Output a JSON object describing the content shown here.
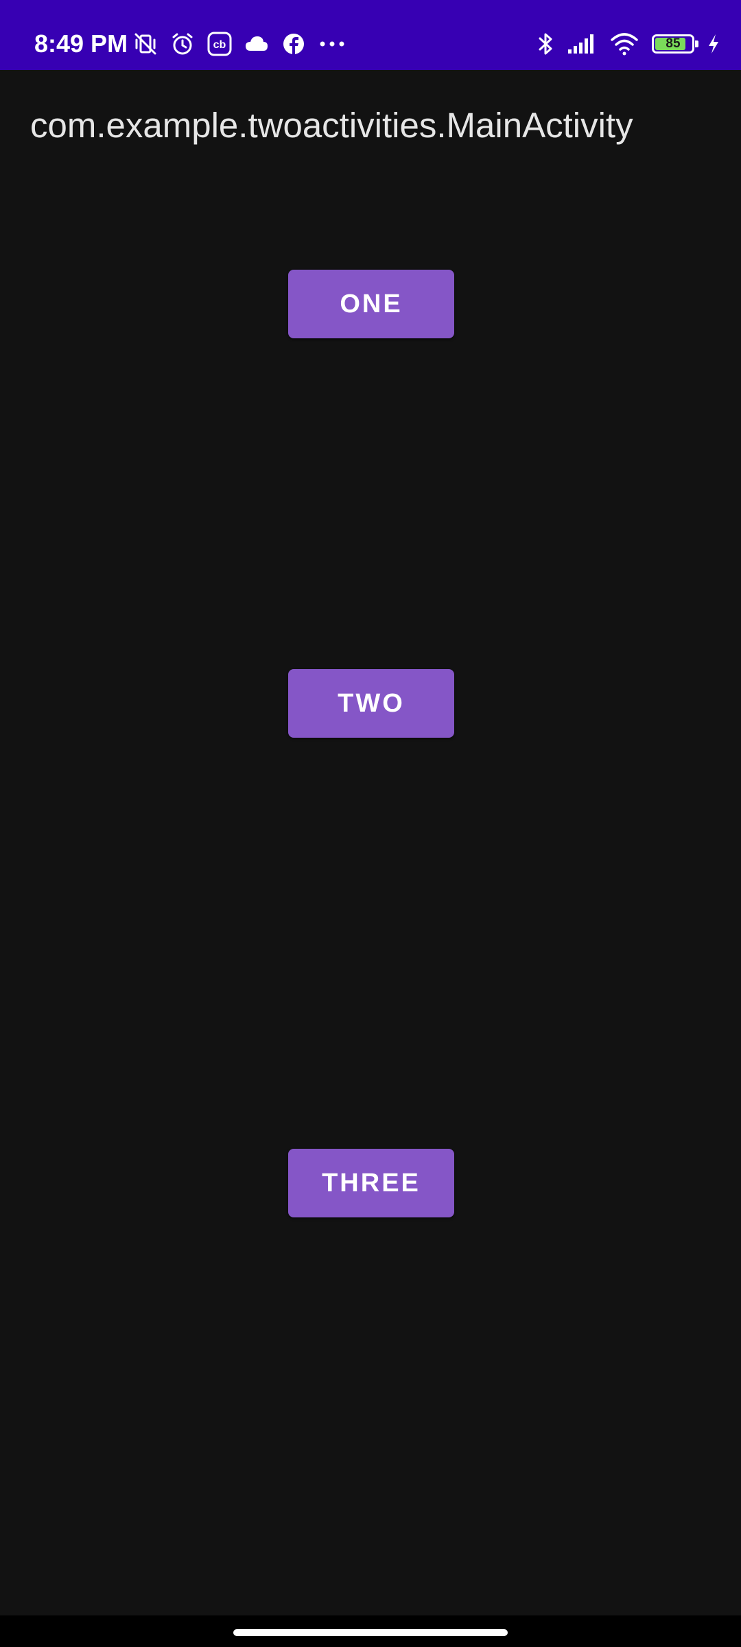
{
  "status_bar": {
    "time": "8:49 PM",
    "battery_level": "85",
    "battery_fraction": 0.85,
    "background_color": "#3700b3",
    "left_icons": [
      "vibrate-off-icon",
      "alarm-icon",
      "cb-app-icon",
      "cloud-icon",
      "facebook-icon",
      "more-dots-icon"
    ],
    "right_icons": [
      "bluetooth-icon",
      "cellular-signal-icon",
      "wifi-icon",
      "battery-icon",
      "charging-bolt-icon"
    ],
    "cb_label": "cb"
  },
  "app_bar": {
    "title": "com.example.twoactivities.MainActivity"
  },
  "buttons": {
    "one": "ONE",
    "two": "TWO",
    "three": "THREE",
    "color": "#8556c7"
  }
}
